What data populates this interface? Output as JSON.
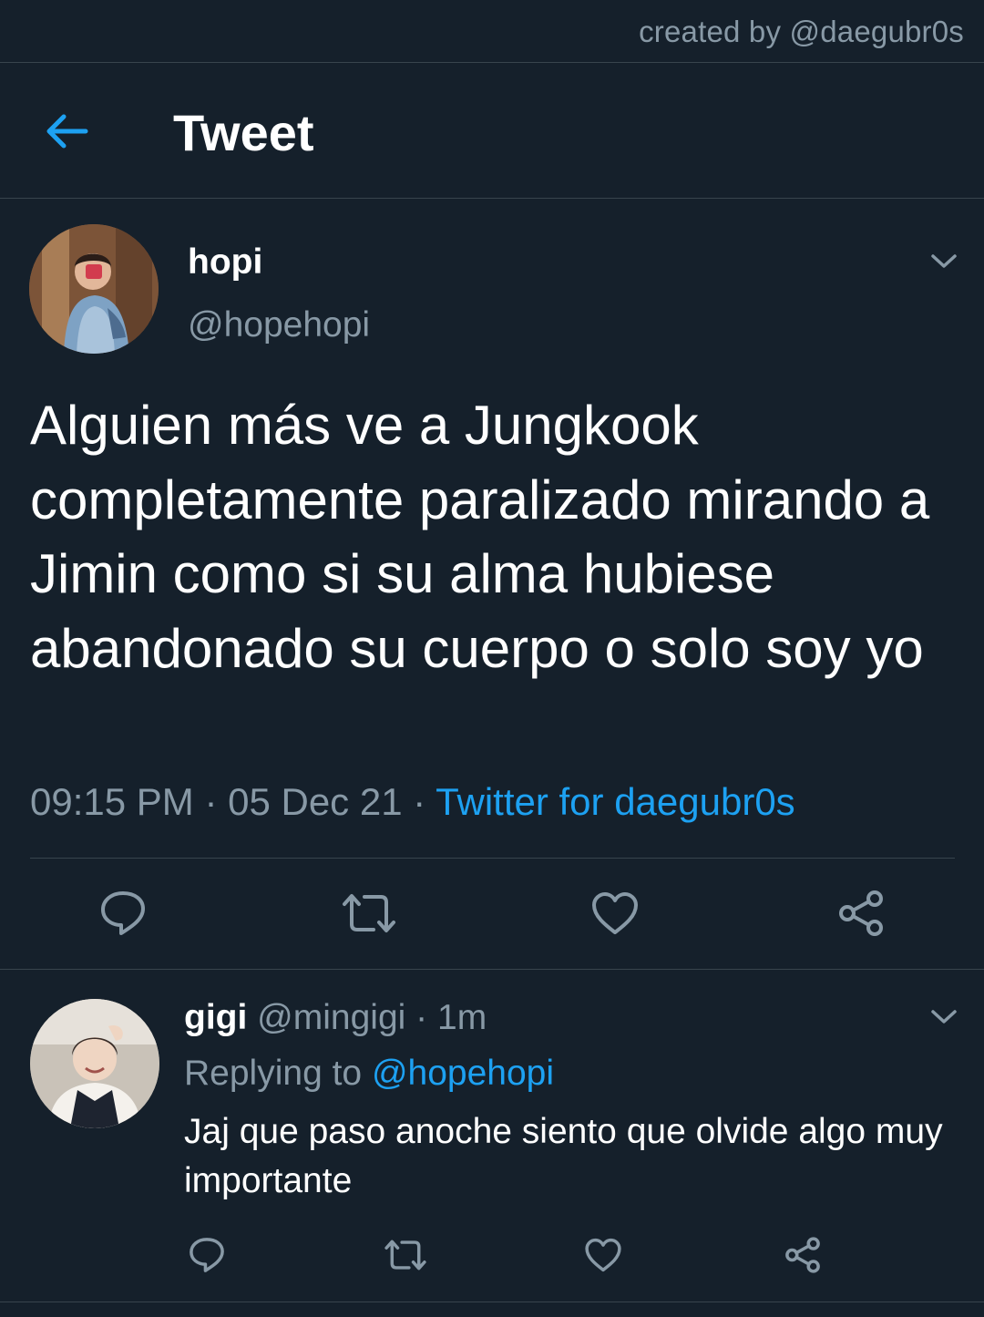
{
  "credit": "created by @daegubr0s",
  "header": {
    "title": "Tweet"
  },
  "tweet": {
    "author_name": "hopi",
    "author_handle": "@hopehopi",
    "text": "Alguien más ve a Jungkook completamente paralizado mirando a Jimin como si su alma hubiese abandonado su cuerpo o solo soy yo",
    "time": "09:15 PM",
    "date": "05 Dec 21",
    "separator": " · ",
    "source": "Twitter for daegubr0s"
  },
  "reply": {
    "author_name": "gigi",
    "author_handle": "@mingigi",
    "separator": " · ",
    "age": "1m",
    "replying_prefix": "Replying to ",
    "replying_handle": "@hopehopi",
    "text": "Jaj que paso anoche siento que olvide algo muy importante"
  },
  "icons": {
    "back": "arrow-left-icon",
    "caret": "chevron-down-icon",
    "reply": "reply-bubble-icon",
    "retweet": "retweet-icon",
    "like": "heart-icon",
    "share": "share-icon"
  },
  "colors": {
    "background": "#15202b",
    "accent": "#1da1f2",
    "secondary_text": "#8899a6",
    "divider": "#38444d"
  }
}
